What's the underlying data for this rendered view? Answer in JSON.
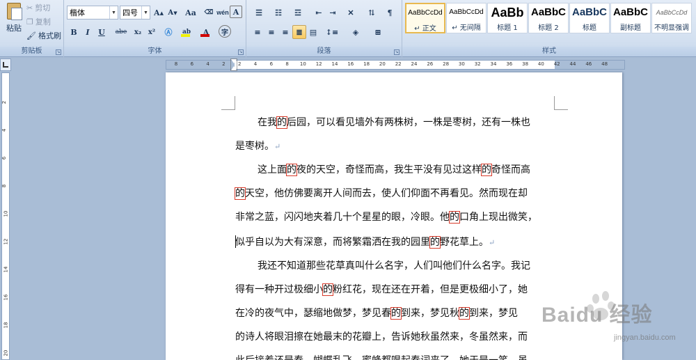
{
  "ribbon": {
    "clipboard": {
      "label": "剪贴板",
      "paste": "粘贴",
      "cut": "剪切",
      "copy": "复制",
      "format_painter": "格式刷"
    },
    "font": {
      "label": "字体",
      "font_name": "楷体",
      "font_size": "四号",
      "grow": "A",
      "shrink": "A",
      "change_case": "Aa",
      "bold": "B",
      "italic": "I",
      "underline": "U",
      "strikethrough": "abe",
      "subscript": "x₂",
      "superscript": "x²",
      "highlight_color": "#f0f000",
      "font_color": "#d00000",
      "phonetic": "wén",
      "char_border": "A",
      "enclose": "字"
    },
    "paragraph": {
      "label": "段落"
    },
    "styles": {
      "label": "样式",
      "items": [
        {
          "sample": "AaBbCcDd",
          "name": "↵ 正文"
        },
        {
          "sample": "AaBbCcDd",
          "name": "↵ 无间隔"
        },
        {
          "sample": "AaBb",
          "name": "标题 1"
        },
        {
          "sample": "AaBbC",
          "name": "标题 2"
        },
        {
          "sample": "AaBbC",
          "name": "标题"
        },
        {
          "sample": "AaBbC",
          "name": "副标题"
        },
        {
          "sample": "AaBbCcDd",
          "name": "不明显强调"
        }
      ]
    }
  },
  "ruler": {
    "h_labels": [
      "8",
      "6",
      "4",
      "2",
      "2",
      "4",
      "6",
      "8",
      "10",
      "12",
      "14",
      "16",
      "18",
      "20",
      "22",
      "24",
      "26",
      "28",
      "30",
      "32",
      "34",
      "36",
      "38",
      "40",
      "42",
      "44",
      "46",
      "48"
    ],
    "v_labels": [
      "2",
      "4",
      "6",
      "8",
      "10",
      "12",
      "14",
      "16",
      "18",
      "20"
    ]
  },
  "document": {
    "lines": [
      [
        {
          "t": "在我"
        },
        {
          "t": "的",
          "m": true
        },
        {
          "t": "后园，可以看见墙外有两株树，一株是枣树，还有一株也"
        }
      ],
      [
        {
          "t": "是枣树。"
        },
        {
          "t": "↵",
          "p": true
        }
      ],
      [
        {
          "t": "这上面"
        },
        {
          "t": "的",
          "m": true
        },
        {
          "t": "夜的天空，奇怪而高，我生平没有见过这样"
        },
        {
          "t": "的",
          "m": true
        },
        {
          "t": "奇怪而高"
        }
      ],
      [
        {
          "t": " 的",
          "m": true
        },
        {
          "t": "天空，他仿佛要离开人间而去，使人们仰面不再看见。然而现在却"
        }
      ],
      [
        {
          "t": "非常之蓝，闪闪地夹着几十个星星的眼，冷眼。他"
        },
        {
          "t": "的",
          "m": true
        },
        {
          "t": "口角上现出微笑，"
        }
      ],
      [
        {
          "t": "似乎自以为大有深意，而将繁霜洒在我的园里"
        },
        {
          "t": "的",
          "m": true
        },
        {
          "t": "野花草上。"
        },
        {
          "t": "↵",
          "p": true
        }
      ],
      [
        {
          "t": "我还不知道那些花草真叫什么名字，人们叫他们什么名字。我记"
        }
      ],
      [
        {
          "t": "得有一种开过极细小"
        },
        {
          "t": "的",
          "m": true
        },
        {
          "t": "粉红花，现在还在开着，但是更极细小了，她"
        }
      ],
      [
        {
          "t": "在冷的夜气中，瑟缩地做梦，梦见春"
        },
        {
          "t": "的",
          "m": true
        },
        {
          "t": "到来，梦见秋"
        },
        {
          "t": "的",
          "m": true
        },
        {
          "t": "到来，梦见"
        }
      ],
      [
        {
          "t": "的诗人将眼泪擦在她最末的花瓣上，告诉她秋虽然来，冬虽然来，而"
        }
      ],
      [
        {
          "t": "此后接着还是春，蝴蝶乱飞，蜜蜂都唱起春词来了。她于是一笑，虽"
        }
      ]
    ]
  },
  "watermark": {
    "logo": "Baidu 经验",
    "url": "jingyan.baidu.com"
  }
}
